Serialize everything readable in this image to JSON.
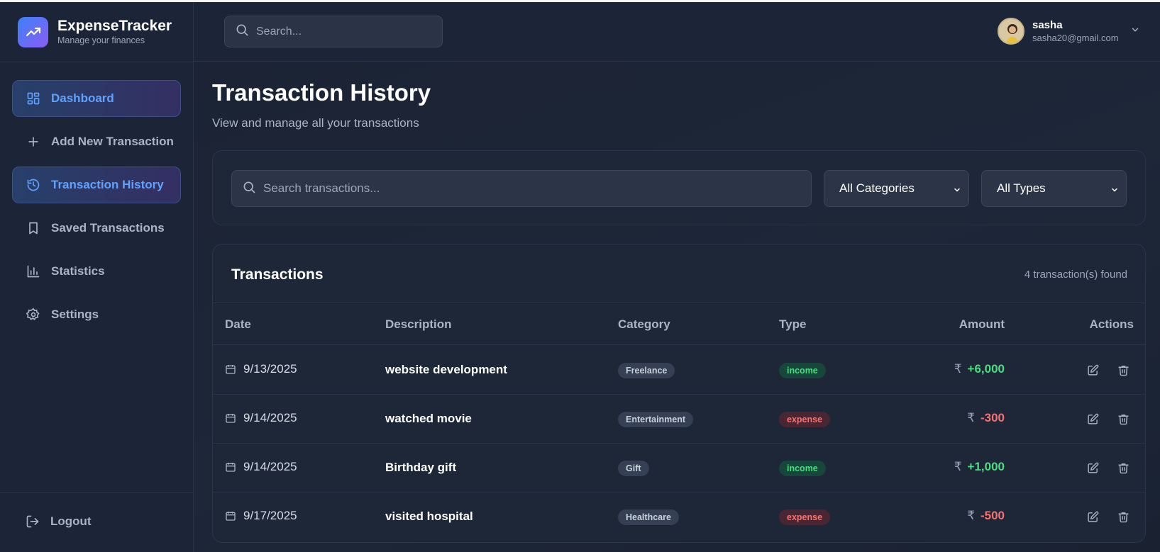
{
  "brand": {
    "title": "ExpenseTracker",
    "subtitle": "Manage your finances",
    "logo_icon": "trending-up-icon"
  },
  "sidebar": {
    "items": [
      {
        "label": "Dashboard",
        "icon": "dashboard-icon",
        "active": true
      },
      {
        "label": "Add New Transaction",
        "icon": "plus-icon",
        "active": false
      },
      {
        "label": "Transaction History",
        "icon": "history-icon",
        "active": true
      },
      {
        "label": "Saved Transactions",
        "icon": "bookmark-icon",
        "active": false
      },
      {
        "label": "Statistics",
        "icon": "bar-chart-icon",
        "active": false
      },
      {
        "label": "Settings",
        "icon": "gear-icon",
        "active": false
      }
    ],
    "logout_label": "Logout"
  },
  "header": {
    "search_placeholder": "Search...",
    "user": {
      "name": "sasha",
      "email": "sasha20@gmail.com"
    }
  },
  "page": {
    "title": "Transaction History",
    "subtitle": "View and manage all your transactions"
  },
  "filters": {
    "search_placeholder": "Search transactions...",
    "category_selected": "All Categories",
    "type_selected": "All Types"
  },
  "transactions": {
    "title": "Transactions",
    "count_text": "4 transaction(s) found",
    "columns": [
      "Date",
      "Description",
      "Category",
      "Type",
      "Amount",
      "Actions"
    ],
    "currency": "₹",
    "rows": [
      {
        "date": "9/13/2025",
        "description": "website development",
        "category": "Freelance",
        "type": "income",
        "amount": "+6,000"
      },
      {
        "date": "9/14/2025",
        "description": "watched movie",
        "category": "Entertainment",
        "type": "expense",
        "amount": "-300"
      },
      {
        "date": "9/14/2025",
        "description": "Birthday gift",
        "category": "Gift",
        "type": "income",
        "amount": "+1,000"
      },
      {
        "date": "9/17/2025",
        "description": "visited hospital",
        "category": "Healthcare",
        "type": "expense",
        "amount": "-500"
      }
    ]
  },
  "colors": {
    "accent": "#5ea3ff",
    "income": "#4ade80",
    "expense": "#f87171",
    "background": "#1a2233"
  }
}
